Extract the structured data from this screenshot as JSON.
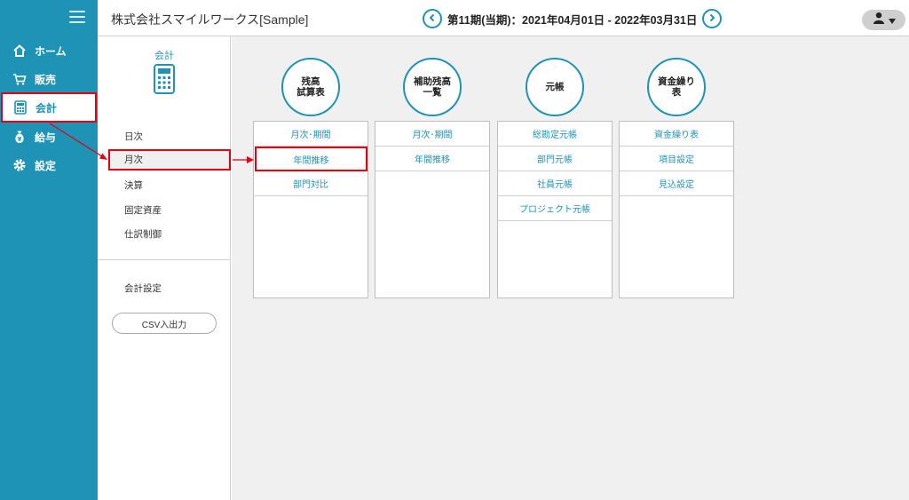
{
  "header": {
    "company": "株式会社スマイルワークス[Sample]",
    "period": "第11期(当期)：2021年04月01日 - 2022年03月31日"
  },
  "leftnav": {
    "items": [
      {
        "label": "ホーム",
        "icon": "home-icon"
      },
      {
        "label": "販売",
        "icon": "cart-icon"
      },
      {
        "label": "会計",
        "icon": "calculator-icon"
      },
      {
        "label": "給与",
        "icon": "money-bag-icon"
      },
      {
        "label": "設定",
        "icon": "gear-icon"
      }
    ]
  },
  "subnav": {
    "title": "会計",
    "items": [
      "日次",
      "月次",
      "決算",
      "固定資産",
      "仕訳制御"
    ],
    "settings": "会計設定",
    "csv": "CSV入出力"
  },
  "main": {
    "columns": [
      {
        "title": "残高\n試算表",
        "items": [
          "月次･期間",
          "年間推移",
          "部門対比"
        ]
      },
      {
        "title": "補助残高\n一覧",
        "items": [
          "月次･期間",
          "年間推移"
        ]
      },
      {
        "title": "元帳",
        "items": [
          "総勘定元帳",
          "部門元帳",
          "社員元帳",
          "プロジェクト元帳"
        ]
      },
      {
        "title": "資金繰り\n表",
        "items": [
          "資金繰り表",
          "項目設定",
          "見込設定"
        ]
      }
    ]
  },
  "colors": {
    "accent": "#1e93b6",
    "highlight": "#e60012",
    "background": "#f0f0f0"
  }
}
